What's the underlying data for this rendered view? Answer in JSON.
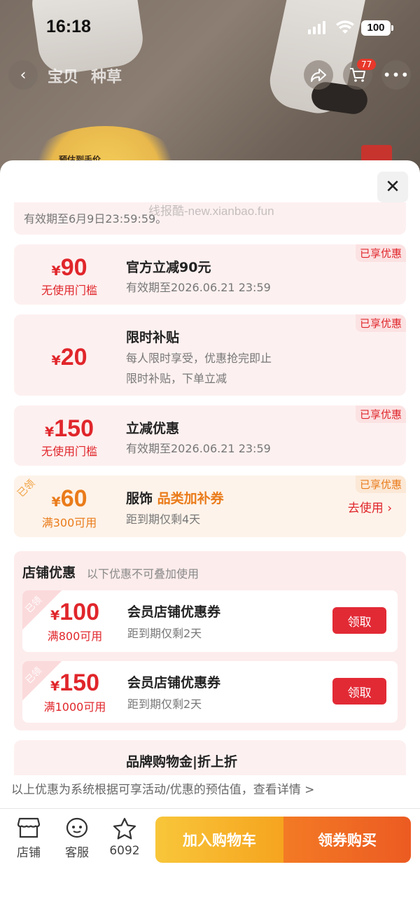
{
  "status_bar": {
    "time": "16:18",
    "battery": "100"
  },
  "nav": {
    "tabs": [
      "宝贝",
      "种草"
    ],
    "cart_count": "77"
  },
  "background": {
    "price_hint": "预估到手价"
  },
  "watermark": "线报酷-new.xianbao.fun",
  "top_card": {
    "text": "有效期至6月9日23:59:59。"
  },
  "coupons": [
    {
      "amount": "90",
      "currency": "¥",
      "condition": "无使用门槛",
      "title": "官方立减90元",
      "sub": [
        "有效期至2026.06.21 23:59"
      ],
      "tag": "已享优惠"
    },
    {
      "amount": "20",
      "currency": "¥",
      "condition": "",
      "title": "限时补贴",
      "sub": [
        "每人限时享受，优惠抢完即止",
        "限时补贴，下单立减"
      ],
      "tag": "已享优惠"
    },
    {
      "amount": "150",
      "currency": "¥",
      "condition": "无使用门槛",
      "title": "立减优惠",
      "sub": [
        "有效期至2026.06.21 23:59"
      ],
      "tag": "已享优惠"
    },
    {
      "amount": "60",
      "currency": "¥",
      "condition": "满300可用",
      "title_prefix": "服饰",
      "title_accent": "品类加补券",
      "sub": [
        "距到期仅剩4天"
      ],
      "tag": "已享优惠",
      "ribbon": "已领",
      "action": "去使用 ›"
    }
  ],
  "store_section": {
    "title": "店铺优惠",
    "note": "以下优惠不可叠加使用",
    "coupons": [
      {
        "ribbon": "已领",
        "currency": "¥",
        "amount": "100",
        "condition": "满800可用",
        "title": "会员店铺优惠券",
        "sub": "距到期仅剩2天",
        "button": "领取"
      },
      {
        "ribbon": "已领",
        "currency": "¥",
        "amount": "150",
        "condition": "满1000可用",
        "title": "会员店铺优惠券",
        "sub": "距到期仅剩2天",
        "button": "领取"
      }
    ]
  },
  "brand_card": {
    "title": "品牌购物金|折上折"
  },
  "footnote": "以上优惠为系统根据可享活动/优惠的预估值，查看详情 >",
  "bottom_bar": {
    "store": "店铺",
    "service": "客服",
    "favorites": "6092",
    "add_to_cart": "加入购物车",
    "claim_and_buy": "领券购买"
  },
  "colors": {
    "red": "#e0262b",
    "orange": "#ea7b1a",
    "claim_button": "#e22a35"
  }
}
